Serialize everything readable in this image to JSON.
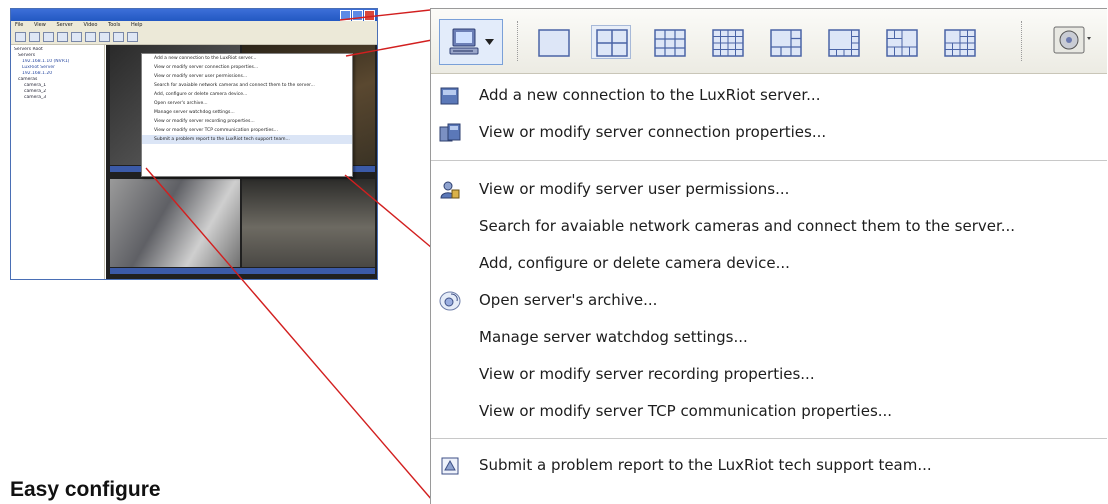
{
  "caption": "Easy configure",
  "thumbnail": {
    "menubar": [
      "File",
      "View",
      "Server",
      "Video",
      "Tools",
      "Help"
    ],
    "tree": [
      "Servers Root",
      "Servers",
      "192.168.1.10 (NVR1)",
      "LuxRiot Server",
      "192.168.1.20",
      "cameras",
      "camera_1",
      "camera_2",
      "camera_3"
    ]
  },
  "toolbar": {
    "connect_button": "connect-server",
    "layouts": [
      "1x1",
      "2x2",
      "3x3",
      "4x4",
      "1+5",
      "1+7",
      "2+8",
      "1+12"
    ],
    "active_layout": "2x2",
    "extra_button": "archive-disk"
  },
  "menu": {
    "items": [
      {
        "label": "Add a new connection to the LuxRiot server...",
        "icon": "server-add-icon"
      },
      {
        "label": "View or modify server connection properties...",
        "icon": "server-properties-icon"
      },
      {
        "label": "View or modify server user permissions...",
        "icon": "user-permissions-icon"
      },
      {
        "label": "Search for avaiable network cameras and connect them to the server...",
        "icon": ""
      },
      {
        "label": "Add, configure or delete camera device...",
        "icon": ""
      },
      {
        "label": "Open server's archive...",
        "icon": "archive-icon"
      },
      {
        "label": "Manage server watchdog settings...",
        "icon": ""
      },
      {
        "label": "View or modify server recording properties...",
        "icon": ""
      },
      {
        "label": "View or modify server TCP communication properties...",
        "icon": ""
      },
      {
        "label": "Submit a problem report to the LuxRiot tech support team...",
        "icon": "report-icon"
      }
    ]
  },
  "colors": {
    "connector": "#d21f1f",
    "accent": "#3c6fd8",
    "menu_text": "#1d1d1d"
  }
}
